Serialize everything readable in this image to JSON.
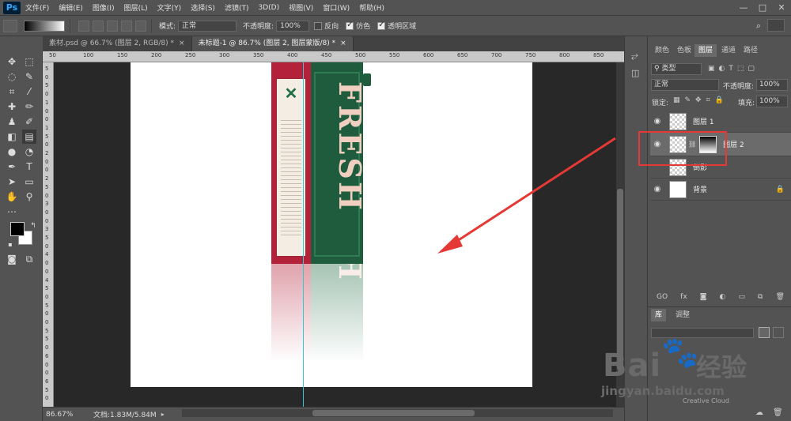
{
  "app": {
    "logo": "Ps"
  },
  "menu": [
    "文件(F)",
    "编辑(E)",
    "图像(I)",
    "图层(L)",
    "文字(Y)",
    "选择(S)",
    "滤镜(T)",
    "3D(D)",
    "视图(V)",
    "窗口(W)",
    "帮助(H)"
  ],
  "window_controls": [
    "—",
    "□",
    "✕"
  ],
  "options_bar": {
    "mode_label": "模式:",
    "mode_value": "正常",
    "opacity_label": "不透明度:",
    "opacity_value": "100%",
    "reverse_label": "反向",
    "dither_label": "仿色",
    "transparency_label": "透明区域",
    "reverse_checked": false,
    "dither_checked": true,
    "transparency_checked": true
  },
  "tabs": [
    {
      "label": "素材.psd @ 66.7% (图层 2, RGB/8) *",
      "close": "×",
      "active": false
    },
    {
      "label": "未标题-1 @ 86.7% (图层 2, 图层蒙版/8) *",
      "close": "×",
      "active": true
    }
  ],
  "ruler_top": [
    "50",
    "100",
    "150",
    "200",
    "250",
    "300",
    "350",
    "400",
    "450",
    "500",
    "550",
    "600",
    "650",
    "700",
    "750",
    "800",
    "850"
  ],
  "ruler_left": [
    "5",
    "0",
    "5",
    "0",
    "1",
    "0",
    "0",
    "1",
    "5",
    "0",
    "2",
    "0",
    "0",
    "2",
    "5",
    "0",
    "3",
    "0",
    "0",
    "3",
    "5",
    "0",
    "4",
    "0",
    "0",
    "4",
    "5",
    "0",
    "5",
    "0",
    "0",
    "5",
    "5",
    "0",
    "6",
    "0",
    "0",
    "6",
    "5",
    "0"
  ],
  "canvas": {
    "product_text": "FRESH"
  },
  "status": {
    "zoom": "86.67%",
    "doc": "文档:1.83M/5.84M"
  },
  "panels": {
    "tabs": [
      "颜色",
      "色板",
      "图层",
      "通道",
      "路径"
    ],
    "active_tab": "图层",
    "filter_label": "类型",
    "blend_mode": "正常",
    "opacity_label": "不透明度:",
    "opacity_value": "100%",
    "lock_label": "锁定:",
    "fill_label": "填充:",
    "fill_value": "100%",
    "layers": [
      {
        "name": "图层 1",
        "selected": false
      },
      {
        "name": "图层 2",
        "selected": true
      },
      {
        "name": "倒影",
        "selected": false
      },
      {
        "name": "背景",
        "selected": false,
        "locked": true
      }
    ],
    "bottom_icons": [
      "GO",
      "fx"
    ]
  },
  "library": {
    "tabs": [
      "库",
      "调整"
    ],
    "active_tab": "库",
    "footer_text": "Creative Cloud"
  },
  "watermark": {
    "brand": "Bai",
    "brand2": "经验",
    "url": "jingyan.baidu.com"
  },
  "colors": {
    "accent": "#31a8ff",
    "annotation": "#e53935",
    "guide": "#36c6d6"
  }
}
